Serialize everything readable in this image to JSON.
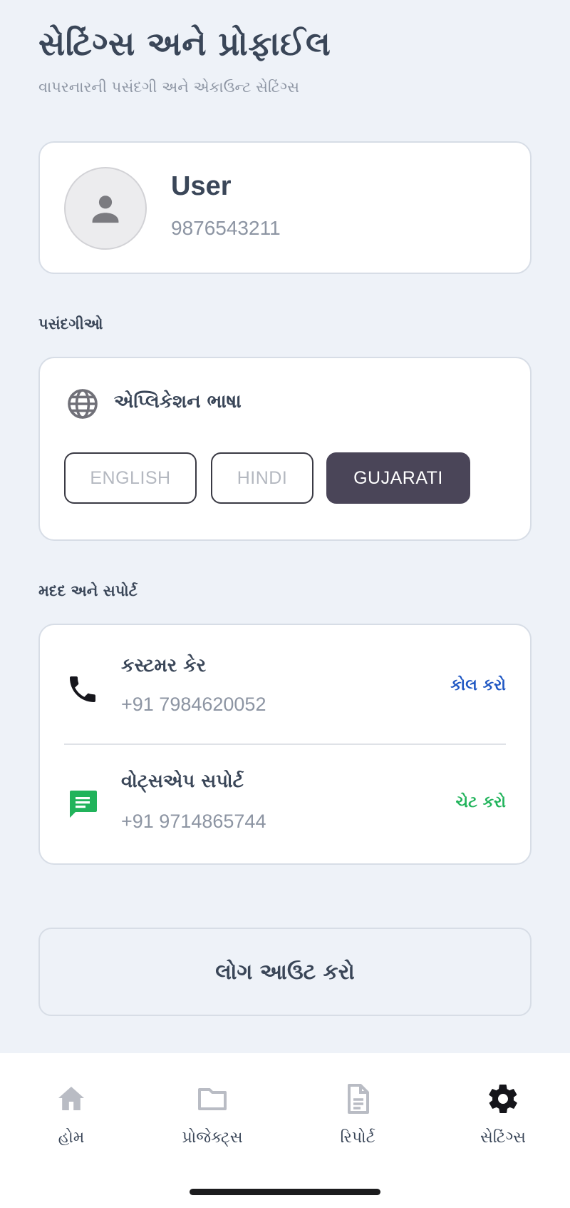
{
  "header": {
    "title": "સેટિંગ્સ અને પ્રોફાઈલ",
    "subtitle": "વાપરનારની પસંદગી અને એકાઉન્ટ સેટિંગ્સ"
  },
  "profile": {
    "name": "User",
    "phone": "9876543211",
    "avatar_icon": "person-icon"
  },
  "preferences": {
    "section_title": "પસંદગીઓ",
    "language_label": "એપ્લિકેશન ભાષા",
    "language_icon": "globe-icon",
    "options": [
      {
        "label": "ENGLISH",
        "selected": false
      },
      {
        "label": "HINDI",
        "selected": false
      },
      {
        "label": "GUJARATI",
        "selected": true
      }
    ],
    "selected_color": "#4a4558"
  },
  "support": {
    "section_title": "મદદ અને સપોર્ટ",
    "items": [
      {
        "title": "કસ્ટમર કેર",
        "number": "+91 7984620052",
        "action": "કોલ કરો",
        "icon": "phone-icon",
        "action_color": "#1f57c3"
      },
      {
        "title": "વોટ્સએપ સપોર્ટ",
        "number": "+91 9714865744",
        "action": "ચેટ કરો",
        "icon": "chat-icon",
        "action_color": "#21b35b"
      }
    ]
  },
  "logout": {
    "label": "લોગ આઉટ કરો"
  },
  "nav": {
    "items": [
      {
        "label": "હોમ",
        "icon": "home-icon",
        "active": false
      },
      {
        "label": "પ્રોજેક્ટ્સ",
        "icon": "folder-icon",
        "active": false
      },
      {
        "label": "રિપોર્ટ",
        "icon": "document-icon",
        "active": false
      },
      {
        "label": "સેટિંગ્સ",
        "icon": "gear-icon",
        "active": true
      }
    ],
    "inactive_color": "#b9bcc4",
    "active_color": "#15151a"
  }
}
